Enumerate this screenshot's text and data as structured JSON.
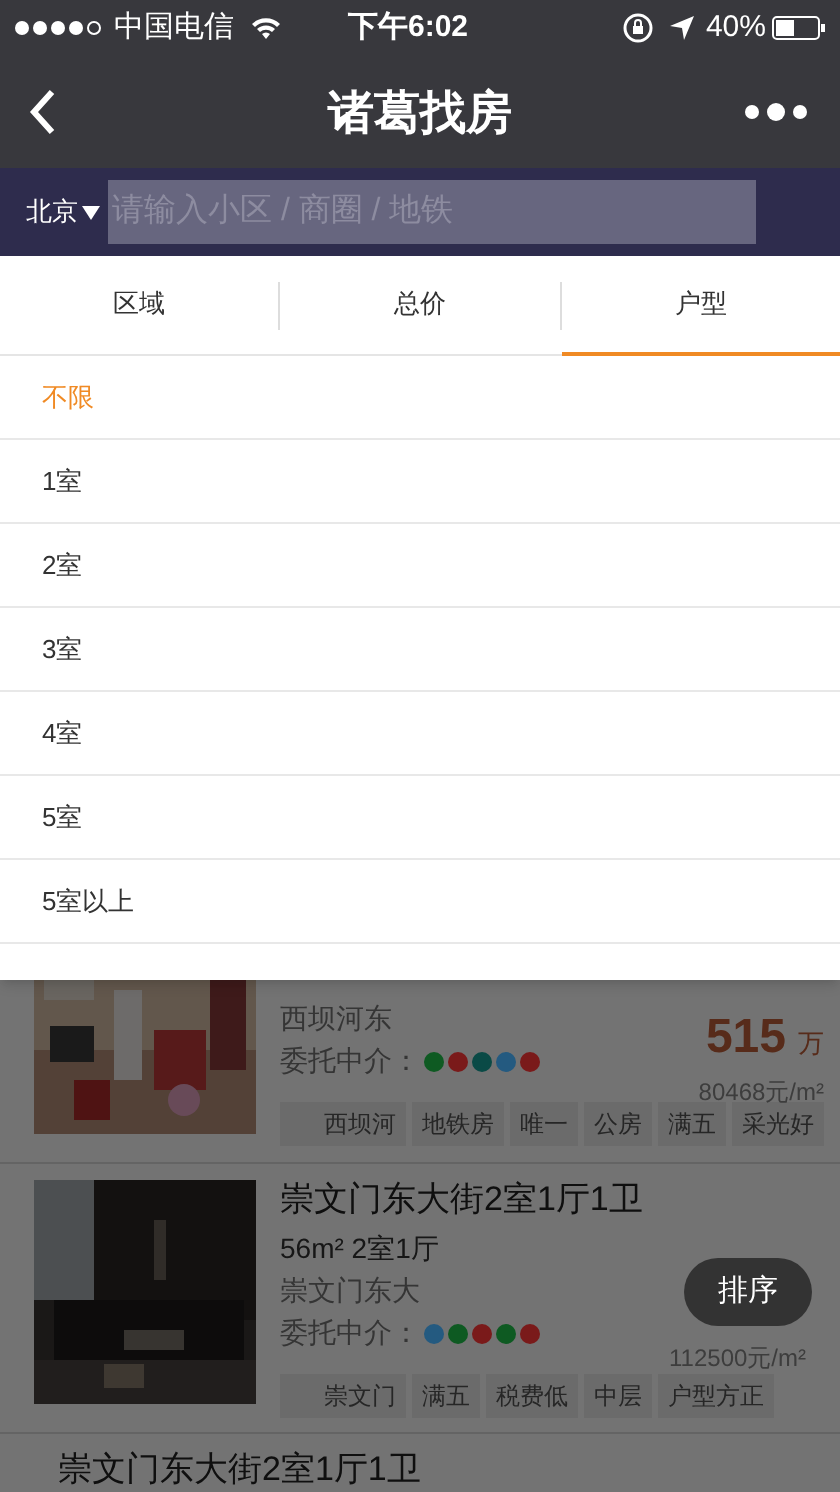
{
  "status_bar": {
    "carrier": "中国电信",
    "time": "下午6:02",
    "battery": "40%"
  },
  "nav": {
    "title": "诸葛找房"
  },
  "search": {
    "city": "北京",
    "placeholder": "请输入小区 / 商圈 / 地铁"
  },
  "tabs": [
    {
      "label": "区域",
      "selected": false
    },
    {
      "label": "总价",
      "selected": false
    },
    {
      "label": "户型",
      "selected": true
    }
  ],
  "options": [
    {
      "label": "不限",
      "selected": true
    },
    {
      "label": "1室",
      "selected": false
    },
    {
      "label": "2室",
      "selected": false
    },
    {
      "label": "3室",
      "selected": false
    },
    {
      "label": "4室",
      "selected": false
    },
    {
      "label": "5室",
      "selected": false
    },
    {
      "label": "5室以上",
      "selected": false
    }
  ],
  "listings": [
    {
      "address": "西坝河东",
      "agents_label": "委托中介：",
      "agents": [
        {
          "color": "#0e5a22"
        },
        {
          "color": "#7a1a1a"
        },
        {
          "color": "#0a4a46"
        },
        {
          "color": "#245a80"
        },
        {
          "color": "#7a1a1a"
        }
      ],
      "price": "515",
      "price_unit": "万",
      "unit_price": "80468元/m²",
      "tags": [
        "西坝河",
        "地铁房",
        "唯一",
        "公房",
        "满五",
        "采光好"
      ]
    },
    {
      "title": "崇文门东大街2室1厅1卫",
      "area": "56m² 2室1厅",
      "address": "崇文门东大",
      "agents_label": "委托中介：",
      "agents": [
        {
          "color": "#245a80"
        },
        {
          "color": "#0e5a22"
        },
        {
          "color": "#7a1a1a"
        },
        {
          "color": "#0e5a22"
        },
        {
          "color": "#7a1a1a"
        }
      ],
      "unit_price": "112500元/m²",
      "tags": [
        "崇文门",
        "满五",
        "税费低",
        "中层",
        "户型方正"
      ]
    },
    {
      "title": "崇文门东大街2室1厅1卫"
    }
  ],
  "sort_button": "排序"
}
